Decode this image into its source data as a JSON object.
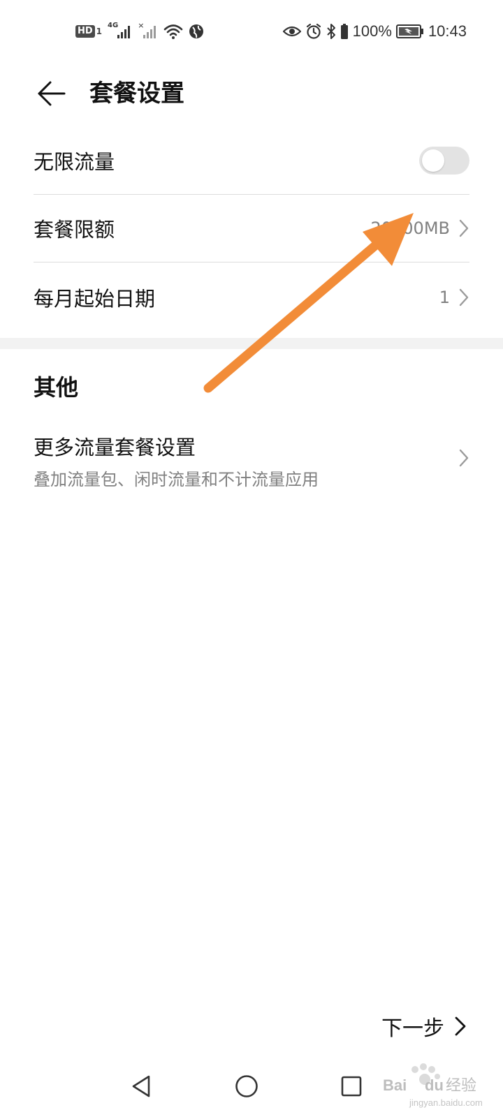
{
  "status_bar": {
    "hd_label": "HD",
    "sim1": "1",
    "net_type": "4G",
    "sim2_x": "×",
    "battery_percent": "100%",
    "time": "10:43",
    "icons": [
      "hd-icon",
      "signal-icon",
      "wifi-icon",
      "globe-icon",
      "eye-icon",
      "alarm-icon",
      "bluetooth-icon",
      "battery-icon"
    ]
  },
  "header": {
    "title": "套餐设置"
  },
  "settings": {
    "unlimited": {
      "label": "无限流量",
      "enabled": false
    },
    "limit": {
      "label": "套餐限额",
      "value": "20000MB"
    },
    "start_date": {
      "label": "每月起始日期",
      "value": "1"
    }
  },
  "other": {
    "section_title": "其他",
    "more_settings": {
      "title": "更多流量套餐设置",
      "subtitle": "叠加流量包、闲时流量和不计流量应用"
    }
  },
  "footer": {
    "next_label": "下一步"
  },
  "colors": {
    "annotation_arrow": "#f28c38",
    "toggle_off": "#e3e3e3",
    "secondary_text": "#808080",
    "section_gap": "#f2f2f2"
  }
}
